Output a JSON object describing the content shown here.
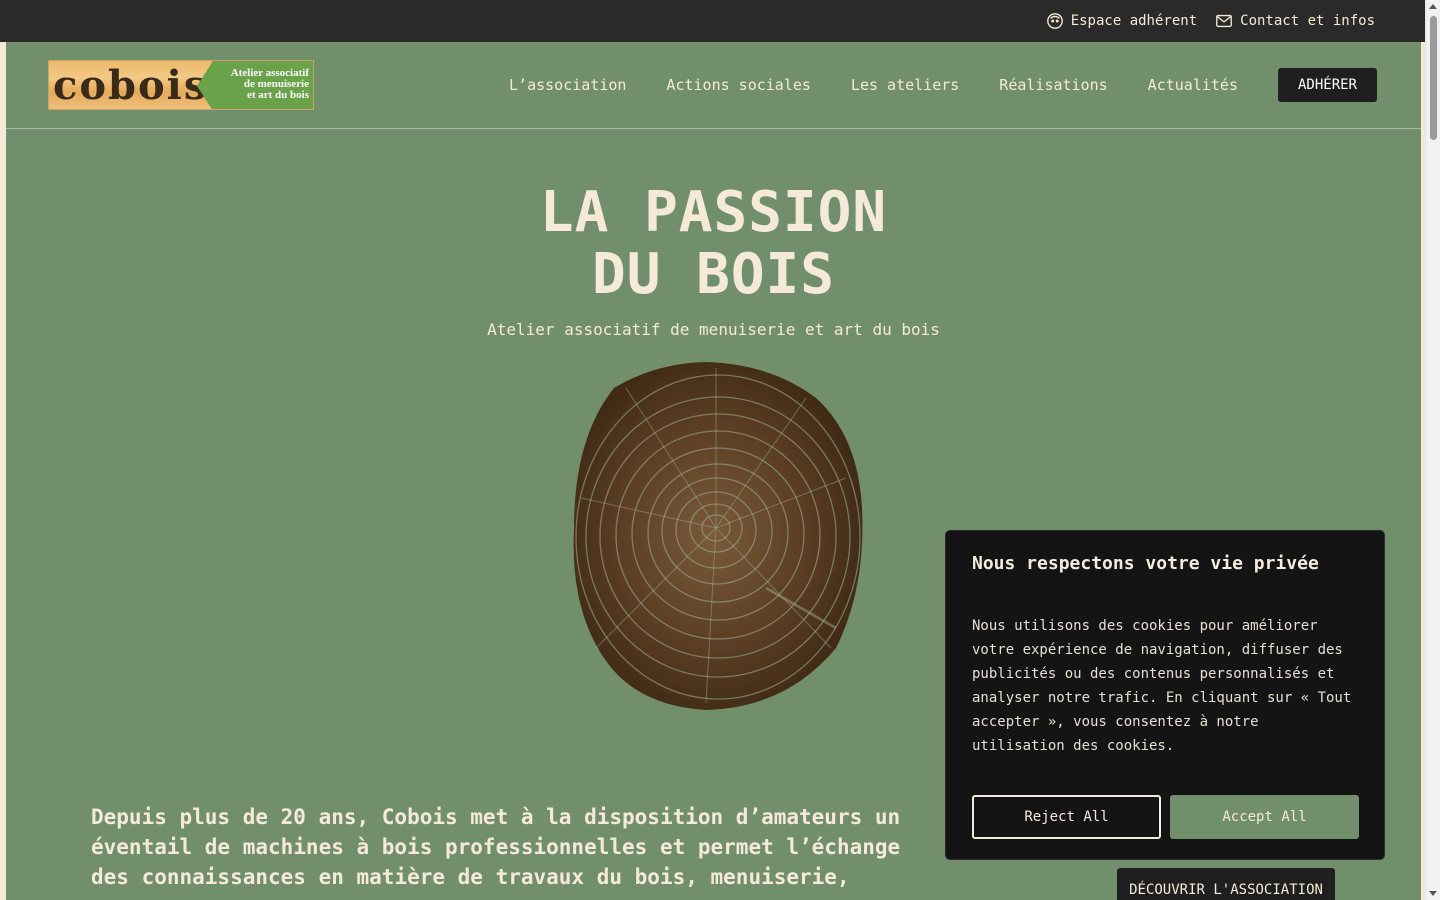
{
  "topbar": {
    "member_label": "Espace adhérent",
    "contact_label": "Contact et infos"
  },
  "header": {
    "logo_word": "cobois",
    "logo_tagline_1": "Atelier associatif",
    "logo_tagline_2": "de menuiserie",
    "logo_tagline_3": "et art du bois",
    "nav": [
      {
        "label": "L’association"
      },
      {
        "label": "Actions sociales"
      },
      {
        "label": "Les ateliers"
      },
      {
        "label": "Réalisations"
      },
      {
        "label": "Actualités"
      }
    ],
    "cta_label": "ADHÉRER"
  },
  "hero": {
    "title_line1": "LA PASSION",
    "title_line2": "DU BOIS",
    "subtitle": "Atelier associatif de menuiserie et art du bois"
  },
  "intro": {
    "text": "Depuis plus de 20 ans, Cobois met à la disposition d’amateurs un éventail de machines à bois professionnelles et permet l’échange des connaissances en matière de travaux du bois, menuiserie,",
    "discover_label": "DÉCOUVRIR L'ASSOCIATION"
  },
  "cookie": {
    "title": "Nous respectons votre vie privée",
    "body": "Nous utilisons des cookies pour améliorer votre expérience de navigation, diffuser des publicités ou des contenus personnalisés et analyser notre trafic. En cliquant sur « Tout accepter », vous consentez à notre utilisation des cookies.",
    "reject_label": "Reject All",
    "accept_label": "Accept All"
  },
  "colors": {
    "topbar": "#2a2a2a",
    "main_bg": "#728f6c",
    "cream_text": "#f5ead7",
    "dark_button": "#1f1f1f",
    "cookie_bg": "#141414"
  },
  "icons": {
    "member": "face-icon",
    "contact": "mail-icon",
    "hero_image": "tree-stump-rings-image"
  }
}
